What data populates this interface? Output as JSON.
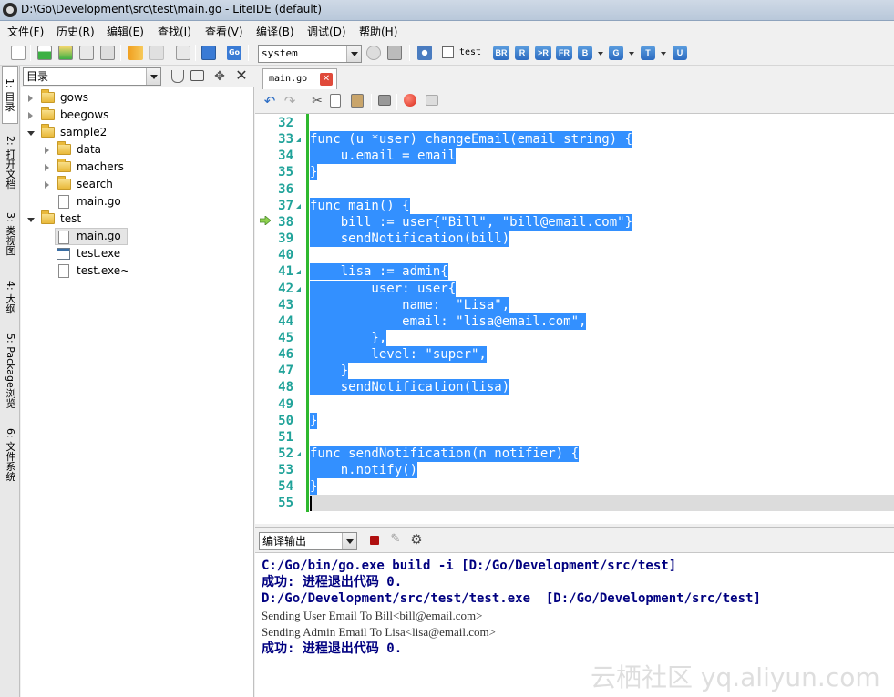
{
  "window": {
    "title": "D:\\Go\\Development\\src\\test\\main.go - LiteIDE (default)"
  },
  "menu": [
    "文件(F)",
    "历史(R)",
    "编辑(E)",
    "查找(I)",
    "查看(V)",
    "编译(B)",
    "调试(D)",
    "帮助(H)"
  ],
  "toolbar": {
    "env_select": "system",
    "test_checkbox_label": "test",
    "checkbox_checked": false,
    "buttons": [
      "BR",
      "R",
      ">R",
      "FR",
      "B",
      "G",
      "T",
      "U"
    ]
  },
  "side_tabs": [
    "1: 目录",
    "2: 打开文档",
    "3: 类视图",
    "4: 大纲",
    "5: Package浏览",
    "6: 文件系统"
  ],
  "file_panel": {
    "view_select": "目录",
    "tree": [
      {
        "label": "gows",
        "kind": "folder",
        "level": 0,
        "expanded": false
      },
      {
        "label": "beegows",
        "kind": "folder",
        "level": 0,
        "expanded": false
      },
      {
        "label": "sample2",
        "kind": "folder",
        "level": 0,
        "expanded": true
      },
      {
        "label": "data",
        "kind": "folder",
        "level": 1,
        "expanded": false
      },
      {
        "label": "machers",
        "kind": "folder",
        "level": 1,
        "expanded": false
      },
      {
        "label": "search",
        "kind": "folder",
        "level": 1,
        "expanded": false
      },
      {
        "label": "main.go",
        "kind": "file",
        "level": 1
      },
      {
        "label": "test",
        "kind": "folder",
        "level": 0,
        "expanded": true
      },
      {
        "label": "main.go",
        "kind": "file",
        "level": 1,
        "selected": true
      },
      {
        "label": "test.exe",
        "kind": "exe",
        "level": 1
      },
      {
        "label": "test.exe~",
        "kind": "file",
        "level": 1
      }
    ]
  },
  "editor": {
    "tab_label": "main.go",
    "lines": [
      {
        "n": "32",
        "text": ""
      },
      {
        "n": "33",
        "text": "func (u *user) changeEmail(email string) {",
        "fold": true
      },
      {
        "n": "34",
        "text": "    u.email = email"
      },
      {
        "n": "35",
        "text": "}"
      },
      {
        "n": "36",
        "text": ""
      },
      {
        "n": "37",
        "text": "func main() {",
        "fold": true
      },
      {
        "n": "38",
        "text": "    bill := user{\"Bill\", \"bill@email.com\"}"
      },
      {
        "n": "39",
        "text": "    sendNotification(bill)"
      },
      {
        "n": "40",
        "text": ""
      },
      {
        "n": "41",
        "text": "    lisa := admin{",
        "fold": true
      },
      {
        "n": "42",
        "text": "        user: user{",
        "fold": true
      },
      {
        "n": "43",
        "text": "            name:  \"Lisa\","
      },
      {
        "n": "44",
        "text": "            email: \"lisa@email.com\","
      },
      {
        "n": "45",
        "text": "        },"
      },
      {
        "n": "46",
        "text": "        level: \"super\","
      },
      {
        "n": "47",
        "text": "    }"
      },
      {
        "n": "48",
        "text": "    sendNotification(lisa)"
      },
      {
        "n": "49",
        "text": ""
      },
      {
        "n": "50",
        "text": "}"
      },
      {
        "n": "51",
        "text": ""
      },
      {
        "n": "52",
        "text": "func sendNotification(n notifier) {",
        "fold": true
      },
      {
        "n": "53",
        "text": "    n.notify()"
      },
      {
        "n": "54",
        "text": "}"
      },
      {
        "n": "55",
        "text": ""
      }
    ]
  },
  "output": {
    "select": "编译输出",
    "lines": [
      {
        "text": "C:/Go/bin/go.exe build -i [D:/Go/Development/src/test]",
        "style": "cmd"
      },
      {
        "text": "成功: 进程退出代码 0.",
        "style": "cmd"
      },
      {
        "text": "D:/Go/Development/src/test/test.exe  [D:/Go/Development/src/test]",
        "style": "cmd"
      },
      {
        "text": "Sending User Email To Bill<bill@email.com>",
        "style": "msg"
      },
      {
        "text": "Sending Admin Email To Lisa<lisa@email.com>",
        "style": "msg"
      },
      {
        "text": "成功: 进程退出代码 0.",
        "style": "cmd"
      }
    ]
  },
  "watermark": "云栖社区 yq.aliyun.com",
  "colors": {
    "selection": "#3390ff",
    "line_number": "#21a39a",
    "change_bar": "#2eb82e",
    "output_cmd": "#000080"
  }
}
